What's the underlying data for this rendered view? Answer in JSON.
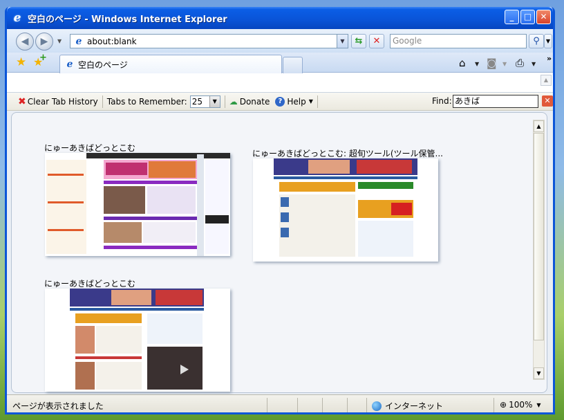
{
  "window": {
    "title": "空白のページ - Windows Internet Explorer",
    "min_label": "_",
    "max_label": "□",
    "close_label": "✕"
  },
  "nav": {
    "address": "about:blank",
    "search_placeholder": "Google",
    "back_icon": "back-arrow-icon",
    "forward_icon": "forward-arrow-icon"
  },
  "tabs": [
    {
      "label": "空白のページ",
      "active": true
    }
  ],
  "toolbar": {
    "clear_label": "Clear Tab History",
    "tabs_remember_label": "Tabs to Remember:",
    "tabs_remember_value": "25",
    "donate_label": "Donate",
    "help_label": "Help",
    "find_label": "Find:",
    "find_value": "あきば"
  },
  "thumbnails": [
    {
      "title": "にゅーあきばどっとこむ"
    },
    {
      "title": "にゅーあきばどっとこむ: 超旬ツール(ツール保管..."
    },
    {
      "title": "にゅーあきばどっとこむ"
    }
  ],
  "status": {
    "text": "ページが表示されました",
    "zone": "インターネット",
    "zoom": "100%"
  },
  "colors": {
    "title_bar": "#0a53d6",
    "accent_red": "#d22222"
  }
}
